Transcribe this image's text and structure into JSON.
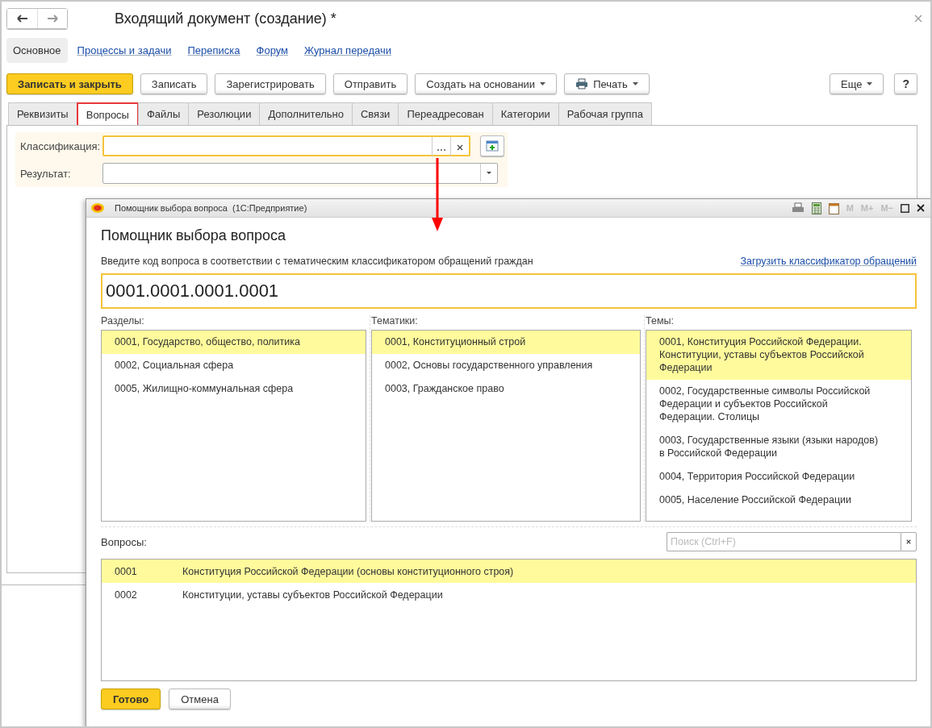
{
  "window": {
    "title": "Входящий документ (создание) *"
  },
  "nav": [
    {
      "label": "Основное",
      "selected": true
    },
    {
      "label": "Процессы и задачи",
      "selected": false
    },
    {
      "label": "Переписка",
      "selected": false
    },
    {
      "label": "Форум",
      "selected": false
    },
    {
      "label": "Журнал передачи",
      "selected": false
    }
  ],
  "toolbar": {
    "buttons": [
      {
        "label": "Записать и закрыть",
        "kind": "primary"
      },
      {
        "label": "Записать",
        "kind": "plain"
      },
      {
        "label": "Зарегистрировать",
        "kind": "plain"
      },
      {
        "label": "Отправить",
        "kind": "plain"
      },
      {
        "label": "Создать на основании",
        "kind": "dropdown"
      },
      {
        "label": "Печать",
        "kind": "print"
      }
    ],
    "right": [
      {
        "label": "Еще",
        "kind": "dropdown"
      },
      {
        "label": "?",
        "kind": "plain"
      }
    ]
  },
  "tabs": [
    {
      "label": "Реквизиты",
      "selected": false
    },
    {
      "label": "Вопросы",
      "selected": true
    },
    {
      "label": "Файлы",
      "selected": false
    },
    {
      "label": "Резолюции",
      "selected": false
    },
    {
      "label": "Дополнительно",
      "selected": false
    },
    {
      "label": "Связи",
      "selected": false
    },
    {
      "label": "Переадресован",
      "selected": false
    },
    {
      "label": "Категории",
      "selected": false
    },
    {
      "label": "Рабочая группа",
      "selected": false
    }
  ],
  "form": {
    "fields": [
      {
        "label": "Классификация:",
        "kind": "choice",
        "focused": true
      },
      {
        "label": "Результат:",
        "kind": "dropdown",
        "focused": false
      }
    ]
  },
  "dialog": {
    "title_bar": "Помощник выбора вопроса  (1С:Предприятие)",
    "memory_keys": [
      "M",
      "M+",
      "M−"
    ],
    "heading": "Помощник выбора вопроса",
    "hint": "Введите код вопроса в соответствии с тематическим классификатором обращений граждан",
    "link": "Загрузить классификатор обращений",
    "code": "0001.0001.0001.0001",
    "columns": [
      {
        "label": "Разделы:",
        "items": [
          {
            "text": "0001, Государство, общество, политика",
            "selected": true
          },
          {
            "text": "0002, Социальная сфера",
            "selected": false
          },
          {
            "text": "0005, Жилищно-коммунальная сфера",
            "selected": false
          }
        ]
      },
      {
        "label": "Тематики:",
        "items": [
          {
            "text": "0001, Конституционный строй",
            "selected": true
          },
          {
            "text": "0002, Основы государственного управления",
            "selected": false
          },
          {
            "text": "0003, Гражданское право",
            "selected": false
          }
        ]
      },
      {
        "label": "Темы:",
        "items": [
          {
            "text": "0001, Конституция Российской Федерации. Конституции, уставы субъектов Российской Федерации",
            "selected": true
          },
          {
            "text": "0002, Государственные символы Российской Федерации и субъектов Российской Федерации. Столицы",
            "selected": false
          },
          {
            "text": "0003, Государственные языки (языки народов) в Российской Федерации",
            "selected": false
          },
          {
            "text": "0004, Территория Российской Федерации",
            "selected": false
          },
          {
            "text": "0005, Население Российской Федерации",
            "selected": false
          }
        ]
      }
    ],
    "questions": {
      "label": "Вопросы:",
      "search_placeholder": "Поиск (Ctrl+F)",
      "rows": [
        {
          "code": "0001",
          "text": "Конституция Российской Федерации (основы конституционного строя)",
          "selected": true
        },
        {
          "code": "0002",
          "text": "Конституции, уставы субъектов Российской Федерации",
          "selected": false
        }
      ]
    },
    "buttons": [
      {
        "label": "Готово",
        "kind": "primary"
      },
      {
        "label": "Отмена",
        "kind": "plain"
      }
    ]
  }
}
